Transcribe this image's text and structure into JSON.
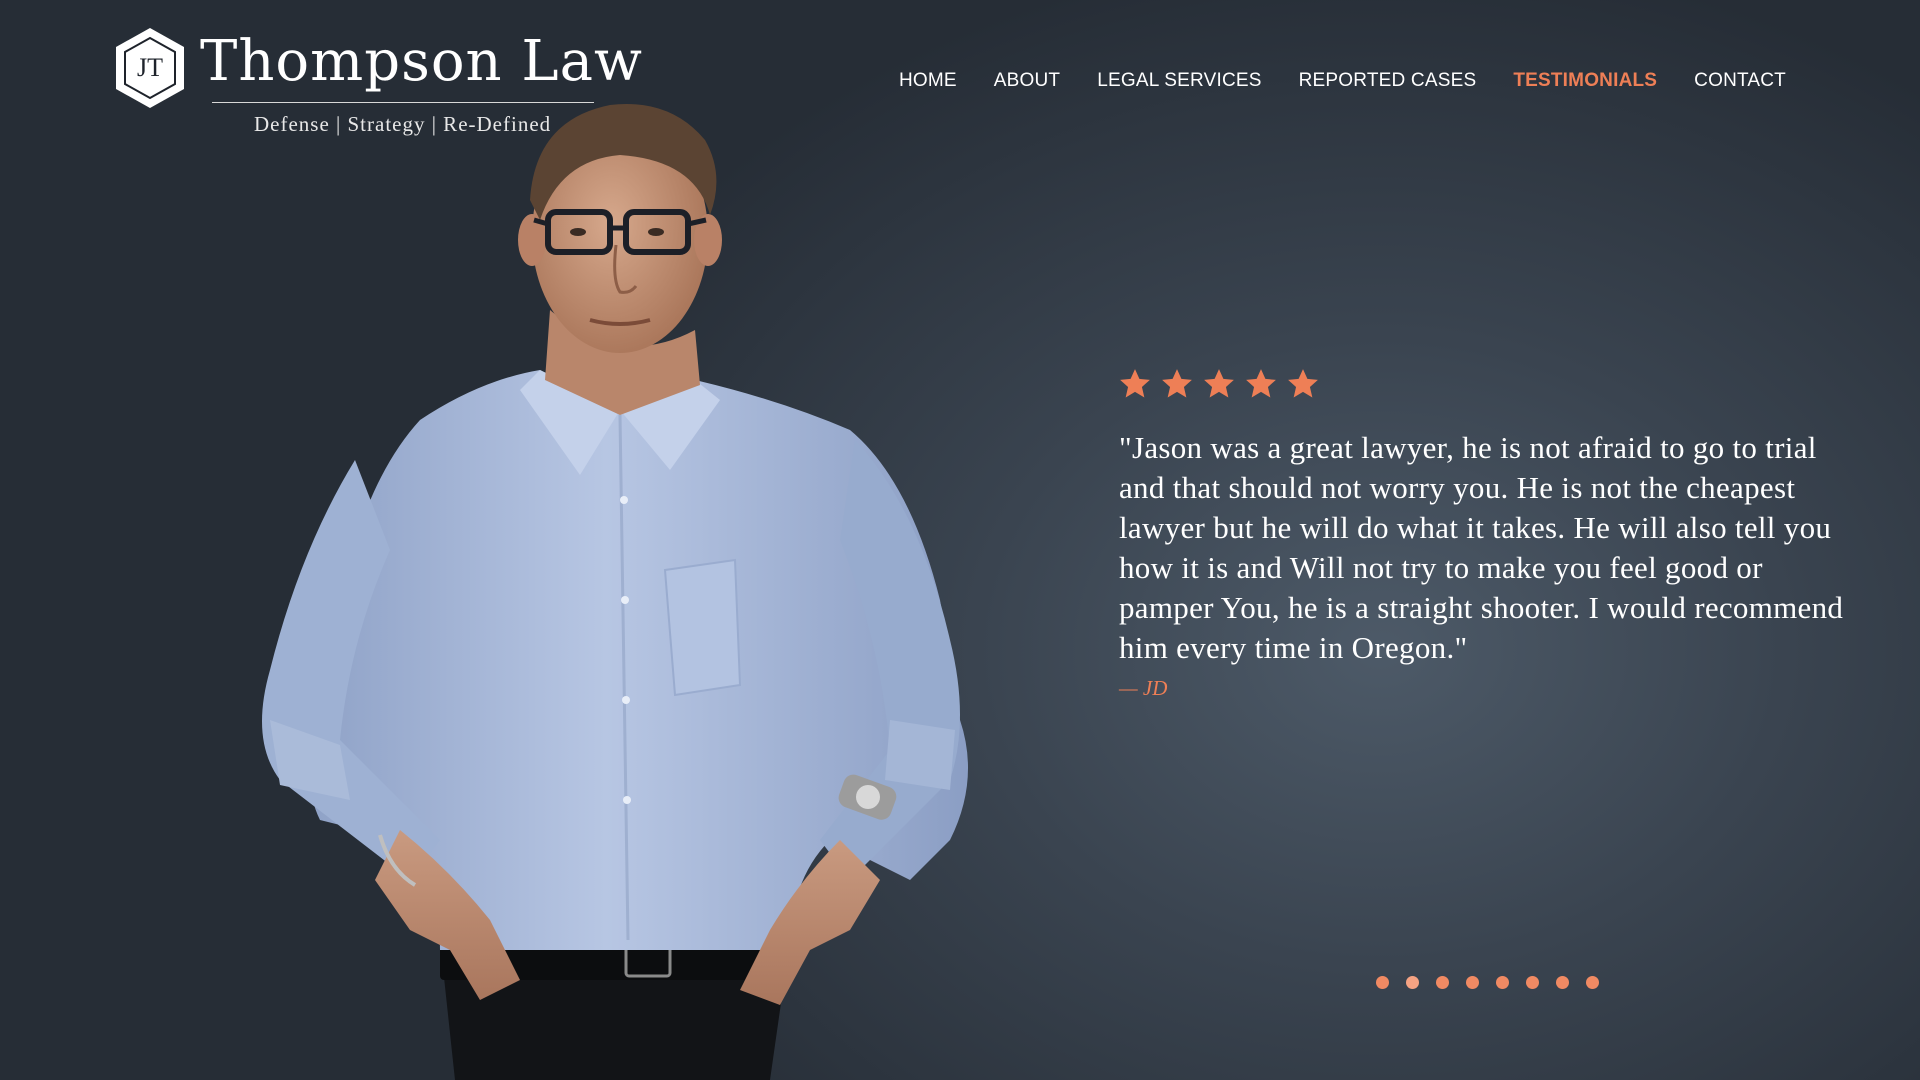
{
  "brand": {
    "monogram": "JT",
    "name": "Thompson Law",
    "tagline": "Defense | Strategy | Re-Defined"
  },
  "nav": {
    "items": [
      {
        "label": "HOME",
        "active": false
      },
      {
        "label": "ABOUT",
        "active": false
      },
      {
        "label": "LEGAL SERVICES",
        "active": false
      },
      {
        "label": "REPORTED CASES",
        "active": false
      },
      {
        "label": "TESTIMONIALS",
        "active": true
      },
      {
        "label": "CONTACT",
        "active": false
      }
    ]
  },
  "testimonial": {
    "rating": 5,
    "rating_max": 5,
    "quote": "\"Jason was a great lawyer, he is not afraid to go to trial and that should not worry you. He is not the cheapest lawyer but he will do what it takes. He will also tell you how it is and Will not try to make you feel good or pamper You, he is a straight shooter. I would recommend him every time in Oregon.\"",
    "author": "— JD"
  },
  "carousel": {
    "slide_count": 8,
    "active_index": 1
  },
  "colors": {
    "accent": "#ee7f56",
    "background": "#3a4450",
    "shirt": "#a9b9d8"
  },
  "icons": {
    "star": "star-icon",
    "logo": "hexagon-monogram-icon"
  }
}
